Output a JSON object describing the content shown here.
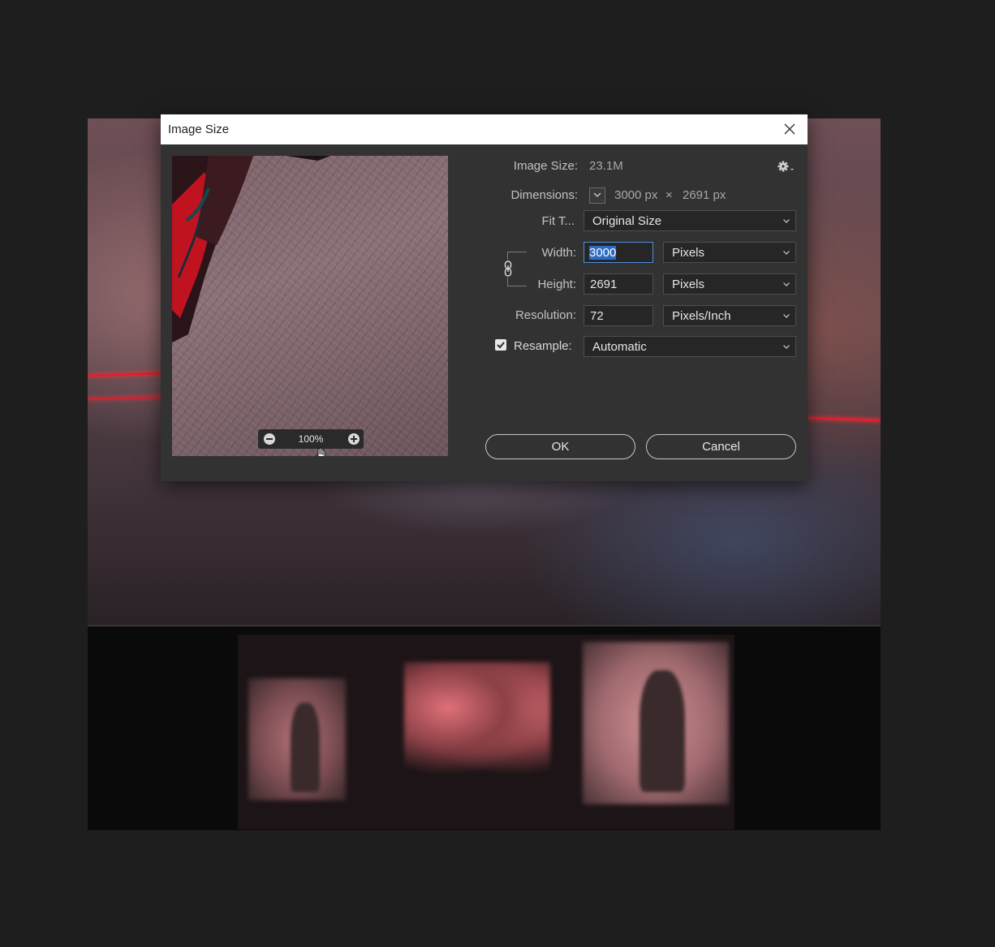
{
  "dialog": {
    "title": "Image Size",
    "image_size": {
      "label": "Image Size:",
      "value": "23.1M"
    },
    "dimensions": {
      "label": "Dimensions:",
      "width": "3000 px",
      "times": "×",
      "height": "2691 px"
    },
    "fit_to": {
      "label": "Fit T...",
      "value": "Original Size"
    },
    "width": {
      "label": "Width:",
      "value": "3000",
      "unit": "Pixels"
    },
    "height": {
      "label": "Height:",
      "value": "2691",
      "unit": "Pixels"
    },
    "resolution": {
      "label": "Resolution:",
      "value": "72",
      "unit": "Pixels/Inch"
    },
    "resample": {
      "label": "Resample:",
      "checked": true,
      "value": "Automatic"
    },
    "preview": {
      "zoom": "100%"
    },
    "buttons": {
      "ok": "OK",
      "cancel": "Cancel"
    }
  },
  "colors": {
    "accent": "#4f8fd8",
    "dialog_bg": "#323232",
    "laser": "#e0202c"
  },
  "icons": [
    "close-icon",
    "gear-icon",
    "chevron-down-icon",
    "link-icon",
    "zoom-out-icon",
    "zoom-in-icon",
    "hand-cursor-icon",
    "checkmark-icon"
  ]
}
